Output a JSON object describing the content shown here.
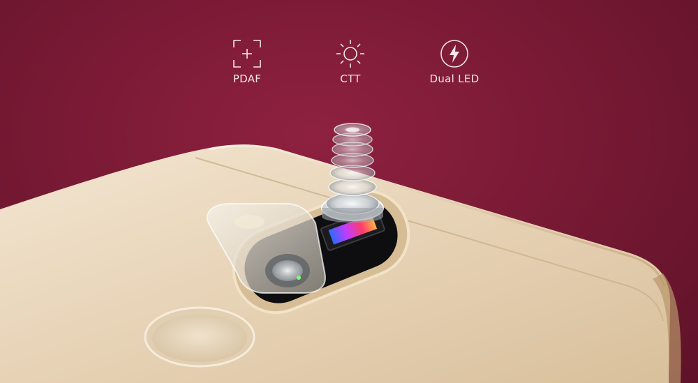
{
  "features": [
    {
      "icon": "focus-frame-icon",
      "label": "PDAF"
    },
    {
      "icon": "sun-icon",
      "label": "CTT"
    },
    {
      "icon": "lightning-bolt-icon",
      "label": "Dual LED"
    }
  ],
  "scene": {
    "subject": "phone rear with exploded camera lens stack",
    "colors": {
      "background": "#7a1a35",
      "phone_body": "#ead8bf",
      "accent_ring": "#d8bf98"
    }
  }
}
